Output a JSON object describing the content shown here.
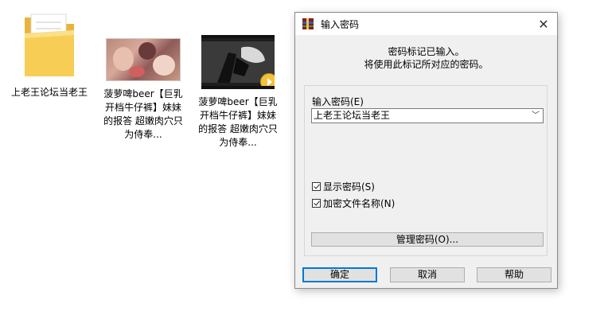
{
  "desktop": {
    "items": [
      {
        "label": "上老王论坛当老王",
        "type": "folder"
      },
      {
        "label": "菠萝啤beer【巨乳开档牛仔裤】妹妹的报答 超嫩肉穴只为侍奉...",
        "type": "video"
      },
      {
        "label": "菠萝啤beer【巨乳开档牛仔裤】妹妹的报答 超嫩肉穴只为侍奉...",
        "type": "video"
      }
    ],
    "play_badge_text": "Player"
  },
  "dialog": {
    "title": "输入密码",
    "close_glyph": "✕",
    "message_line1": "密码标记已输入。",
    "message_line2": "将使用此标记所对应的密码。",
    "password_label": "输入密码(E)",
    "password_value": "上老王论坛当老王",
    "dropdown_glyph": "﹀",
    "show_password_label": "显示密码(S)",
    "show_password_checked": true,
    "encrypt_names_label": "加密文件名称(N)",
    "encrypt_names_checked": true,
    "manage_button": "管理密码(O)...",
    "ok_button": "确定",
    "cancel_button": "取消",
    "help_button": "帮助"
  },
  "colors": {
    "accent": "#0078d7",
    "dialog_bg": "#f0f0f0",
    "folder": "#f5c542"
  }
}
